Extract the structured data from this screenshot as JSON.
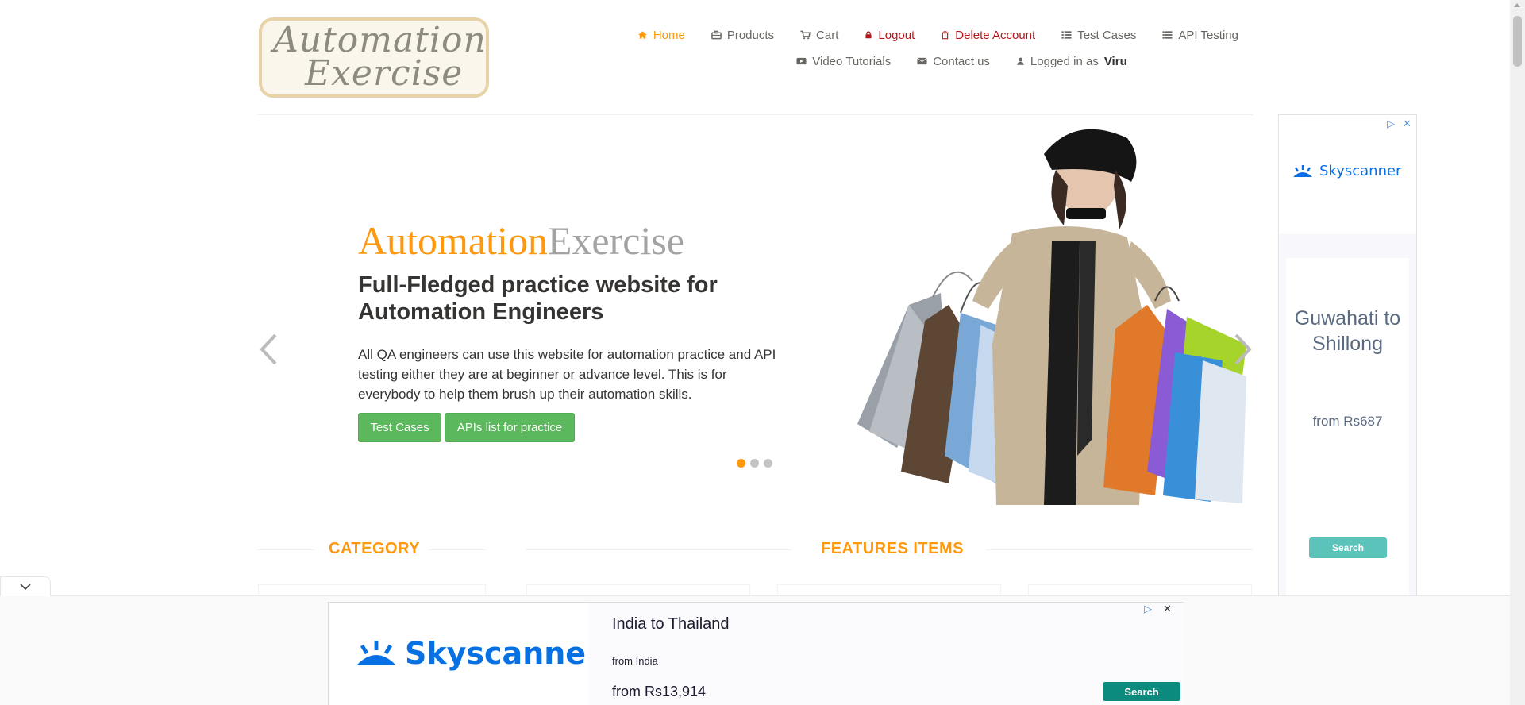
{
  "logo": {
    "line1": "Automation",
    "line2": "Exercise"
  },
  "nav": {
    "home": "Home",
    "products": "Products",
    "cart": "Cart",
    "logout": "Logout",
    "delete_account": "Delete Account",
    "test_cases": "Test Cases",
    "api_testing": "API Testing",
    "video_tutorials": "Video Tutorials",
    "contact_us": "Contact us",
    "logged_in_prefix": "Logged in as",
    "logged_in_user": "Viru"
  },
  "slider": {
    "title_part1": "Automation",
    "title_part2": "Exercise",
    "heading": "Full-Fledged practice website for Automation Engineers",
    "description": "All QA engineers can use this website for automation practice and API testing either they are at beginner or advance level. This is for everybody to help them brush up their automation skills.",
    "btn_test_cases": "Test Cases",
    "btn_apis": "APIs list for practice",
    "slide_count": 3,
    "active_slide": 1
  },
  "sections": {
    "category": "CATEGORY",
    "features": "FEATURES ITEMS"
  },
  "ad_right": {
    "brand": "Skyscanner",
    "route": "Guwahati to Shillong",
    "price": "from Rs687",
    "search": "Search"
  },
  "ad_bottom": {
    "brand": "Skyscanner",
    "route": "India to Thailand",
    "from": "from India",
    "price": "from Rs13,914",
    "search": "Search"
  },
  "icons": {
    "home": "home-icon",
    "products": "briefcase-icon",
    "cart": "shopping-cart-icon",
    "logout": "lock-icon",
    "delete": "trash-icon",
    "test_cases": "list-icon",
    "api": "list-icon",
    "video": "youtube-play-icon",
    "contact": "envelope-icon",
    "user": "user-icon"
  },
  "colors": {
    "accent": "#fe980f",
    "danger": "#b5171a",
    "success": "#5cb85c",
    "brand_blue": "#0770e3"
  }
}
